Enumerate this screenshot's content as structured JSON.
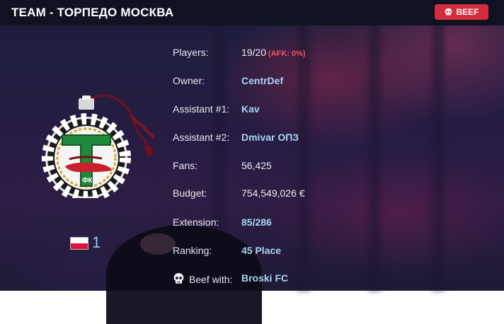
{
  "header": {
    "title": "TEAM - ТОРПЕДО МОСКВА",
    "beef_button_label": "BEEF"
  },
  "team": {
    "country_flag": "poland-flag",
    "rank_number": "1"
  },
  "info": {
    "players_label": "Players:",
    "players_value": "19/20",
    "afk_value": "(AFK: 0%)",
    "owner_label": "Owner:",
    "owner_value": "CentrDef",
    "assistant1_label": "Assistant #1:",
    "assistant1_value": "Kav",
    "assistant2_label": "Assistant #2:",
    "assistant2_value": "Dmivar ОПЗ",
    "fans_label": "Fans:",
    "fans_value": "56,425",
    "budget_label": "Budget:",
    "budget_value": "754,549,026 €",
    "extension_label": "Extension:",
    "extension_value": "85/286",
    "ranking_label": "Ranking:",
    "ranking_value": "45 Place",
    "beef_with_label": "Beef with:",
    "beef_with_value": "Broski FC"
  },
  "colors": {
    "header_bg": "#0f1220",
    "beef_red": "#d42e3c",
    "link_blue": "#a9d4f2",
    "afk_red": "#ff4f5e",
    "crest_green": "#1f8a3b"
  },
  "icons": {
    "beef_button_icon": "skull-icon",
    "beef_with_icon": "skull-icon",
    "crest": "torpedo-crest-ornament"
  }
}
